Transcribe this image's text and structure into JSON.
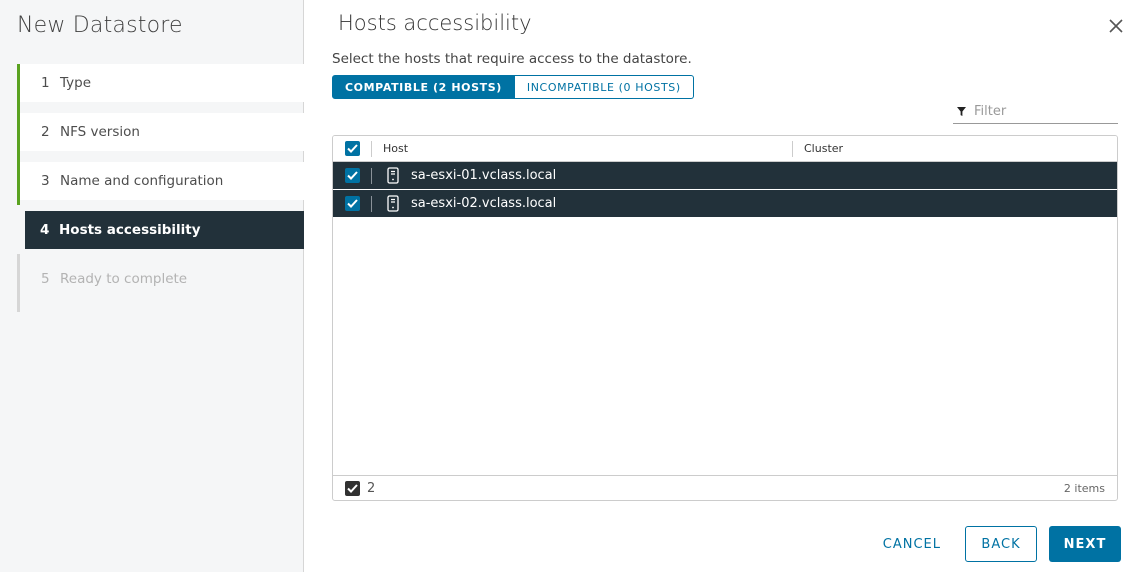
{
  "wizard": {
    "title": "New Datastore",
    "steps": [
      {
        "num": "1",
        "label": "Type"
      },
      {
        "num": "2",
        "label": "NFS version"
      },
      {
        "num": "3",
        "label": "Name and configuration"
      },
      {
        "num": "4",
        "label": "Hosts accessibility"
      },
      {
        "num": "5",
        "label": "Ready to complete"
      }
    ]
  },
  "page": {
    "title": "Hosts accessibility",
    "subtitle": "Select the hosts that require access to the datastore."
  },
  "toggle": {
    "compatible": "COMPATIBLE (2 HOSTS)",
    "incompatible": "INCOMPATIBLE (0 HOSTS)"
  },
  "filter": {
    "placeholder": "Filter"
  },
  "grid": {
    "columns": {
      "host": "Host",
      "cluster": "Cluster"
    },
    "rows": [
      {
        "host": "sa-esxi-01.vclass.local",
        "cluster": "",
        "checked": true
      },
      {
        "host": "sa-esxi-02.vclass.local",
        "cluster": "",
        "checked": true
      }
    ],
    "selected_count": "2",
    "total": "2 items"
  },
  "actions": {
    "cancel": "CANCEL",
    "back": "BACK",
    "next": "NEXT"
  },
  "colors": {
    "accent": "#0072a3",
    "selected_row": "#22313a",
    "done_step": "#5aa220"
  }
}
